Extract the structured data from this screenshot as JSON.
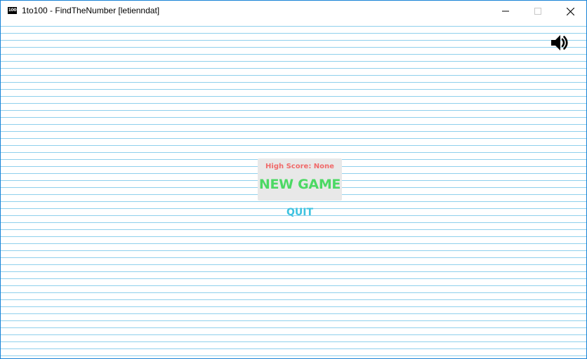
{
  "window": {
    "title": "1to100 - FindTheNumber [letienndat]",
    "icon_text": "100",
    "controls": {
      "minimize": "minimize-icon",
      "maximize": "maximize-icon",
      "close": "close-icon"
    }
  },
  "game": {
    "sound_icon": "speaker-volume-icon",
    "high_score_label": "High Score: None",
    "new_game_label": "NEW GAME",
    "quit_label": "QUIT"
  },
  "colors": {
    "line": "#8fd0ec",
    "high_score": "#f06a6a",
    "new_game": "#4cd964",
    "quit": "#3ec3e0",
    "menu_box": "#e8e8e8"
  }
}
